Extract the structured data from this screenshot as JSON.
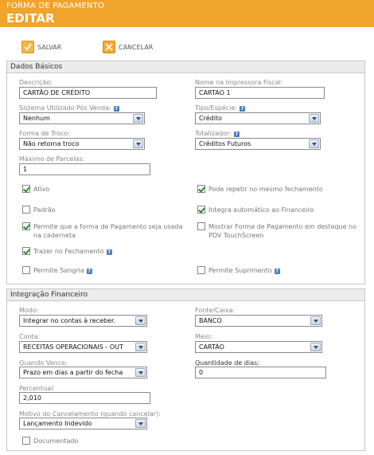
{
  "header": {
    "subtitle": "FORMA DE PAGAMENTO",
    "title": "EDITAR"
  },
  "toolbar": {
    "save_label": "SALVAR",
    "cancel_label": "CANCELAR"
  },
  "dados_basicos": {
    "title": "Dados Básicos",
    "descricao": {
      "label": "Descrição:",
      "value": "CARTÃO DE CRÉDITO"
    },
    "nome_impressora": {
      "label": "Nome na Impressora Fiscal:",
      "value": "CARTAO 1"
    },
    "sistema_pos_venda": {
      "label": "Sistema Utilizado Pós Venda:",
      "value": "Nenhum"
    },
    "tipo_especie": {
      "label": "Tipo/Espécie:",
      "value": "Crédito"
    },
    "forma_troco": {
      "label": "Forma de Troco:",
      "value": "Não retorna troco"
    },
    "totalizador": {
      "label": "Totalizador:",
      "value": "Créditos Futuros"
    },
    "max_parcelas": {
      "label": "Máximo de Parcelas:",
      "value": "1"
    },
    "checks": {
      "ativo": {
        "label": "Ativo",
        "checked": true
      },
      "pode_repetir": {
        "label": "Pode repetir no mesmo fechamento",
        "checked": true
      },
      "padrao": {
        "label": "Padrão",
        "checked": false
      },
      "integra_auto": {
        "label": "Integra automático ao Financeiro",
        "checked": true
      },
      "permite_caderneta": {
        "label": "Permite que a forma de Pagamento seja usada na caderneta",
        "checked": true
      },
      "mostrar_destaque": {
        "label": "Mostrar Forma de Pagamento em destaque no PDV TouchScreen",
        "checked": false
      },
      "trazer_fechamento": {
        "label": "Trazer no Fechamento",
        "checked": true
      },
      "permite_sangria": {
        "label": "Permite Sangria",
        "checked": false
      },
      "permite_suprimento": {
        "label": "Permite Suprimento",
        "checked": false
      }
    }
  },
  "integracao": {
    "title": "Integração Financeiro",
    "modo": {
      "label": "Modo:",
      "value": "Integrar no contas à receber."
    },
    "fonte_caixa": {
      "label": "Fonte/Caixa:",
      "value": "BANCO"
    },
    "conta": {
      "label": "Conta:",
      "value": "RECEITAS OPERACIONAIS - OUT"
    },
    "meio": {
      "label": "Meio:",
      "value": "CARTÃO"
    },
    "quando_vence": {
      "label": "Quando Vence:",
      "value": "Prazo em dias a partir do fecha"
    },
    "quantidade_dias": {
      "label": "Quantidade de dias:",
      "value": "0"
    },
    "percentual": {
      "label": "Percentual:",
      "value": "2,010"
    },
    "motivo_cancelamento": {
      "label": "Motivo do Cancelamento (quando cancelar):",
      "value": "Lançamento Indevido"
    },
    "documentado": {
      "label": "Documentado",
      "checked": false
    }
  },
  "colors": {
    "header": "#f0a42c",
    "check": "#2e8b2e",
    "help": "#4a7fc1"
  },
  "icons": {
    "save": "checkmark-icon",
    "cancel": "x-icon",
    "help": "question-icon"
  }
}
